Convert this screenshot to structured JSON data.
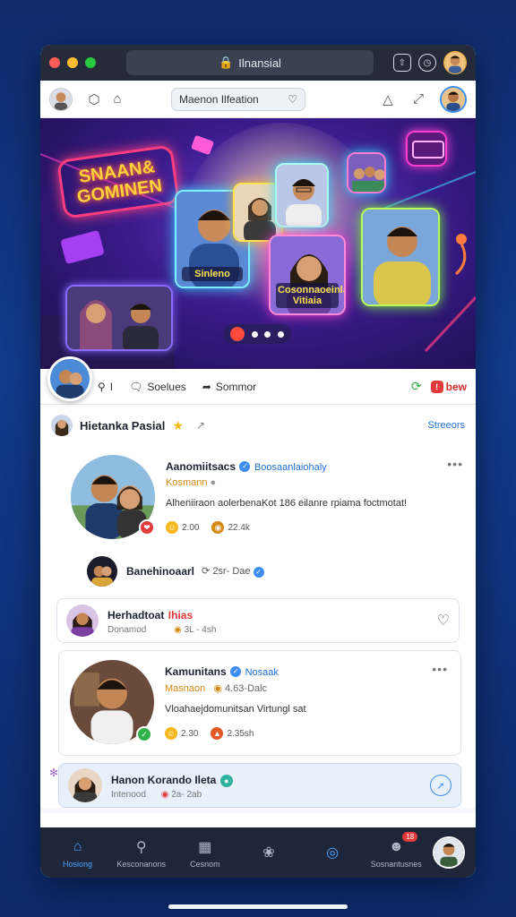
{
  "browser": {
    "url": "Ilnansial",
    "lock_icon": "lock-icon",
    "buttons": [
      "upload-icon",
      "clock-icon"
    ]
  },
  "toolbar": {
    "search_value": "Maenon Ilfeation",
    "icons": [
      "hexagon-icon",
      "home-icon",
      "bell-icon",
      "expand-icon"
    ]
  },
  "hero": {
    "neon_title": "SNAAN& GOMINEN",
    "card_one_label": "Sinleno",
    "card_two_label": "Cosonnaoeinlais Vitiaia"
  },
  "actions": {
    "search_label": "I",
    "comments_label": "Soelues",
    "share_label": "Sommor",
    "new_label": "bew"
  },
  "feed": {
    "header_title": "Hietanka Pasial",
    "header_link": "Streeors",
    "posts": [
      {
        "name": "Aanomiitsacs",
        "handle": "Boosaanlaiohaly",
        "sub": "Kosmann",
        "text": "Alheniiraon aolerbenaKot 186 eilanre rpiama foctmotat!",
        "likes": "2.00",
        "views": "22.4k"
      },
      {
        "name": "Banehinoaarl",
        "meta": "2sr- Dae"
      },
      {
        "name": "Herhadtoat",
        "tag": "Ihias",
        "sub": "Donamod",
        "meta": "3L - 4sh"
      },
      {
        "name": "Kamunitans",
        "handle": "Nosaak",
        "sub": "Masnaon",
        "meta": "4.63-Dalc",
        "text": "Vloahaejdomunitsan Virtungl sat",
        "likes": "2.30",
        "views": "2.35sh"
      },
      {
        "name": "Hanon Korando Ileta",
        "sub": "Intenood",
        "meta": "2a- 2ab"
      }
    ]
  },
  "bottomnav": {
    "items": [
      {
        "label": "Hosiong",
        "icon": "home-icon"
      },
      {
        "label": "Kesconanons",
        "icon": "search-icon"
      },
      {
        "label": "Cesnom",
        "icon": "grid-icon"
      },
      {
        "label": "",
        "icon": "mic-icon"
      },
      {
        "label": "",
        "icon": "target-icon"
      },
      {
        "label": "Sosnantusnes",
        "icon": "user-icon",
        "badge": "18"
      }
    ]
  },
  "colors": {
    "accent": "#1f6fd6",
    "nav_bg": "#20263a",
    "page_bg": "#123a8c"
  }
}
